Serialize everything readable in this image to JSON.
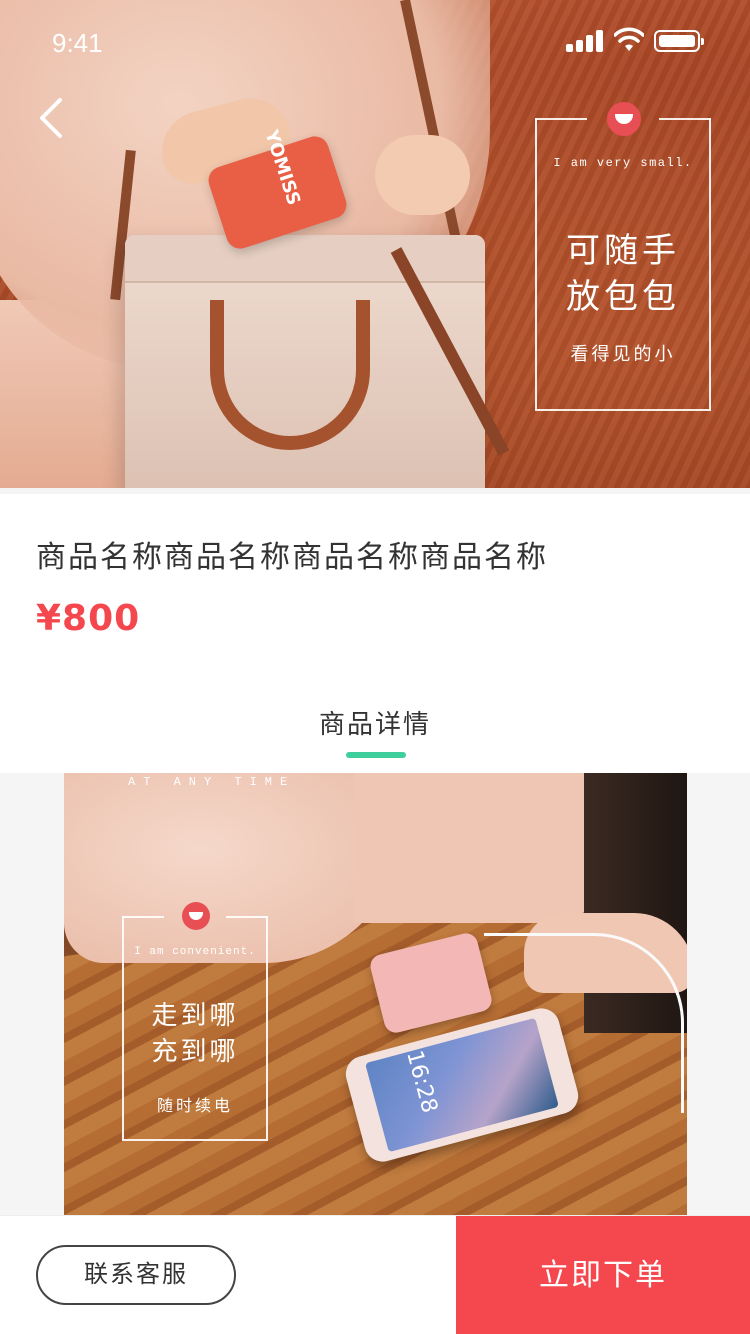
{
  "status_bar": {
    "time": "9:41"
  },
  "hero": {
    "promo": {
      "tagline_en": "I am very small.",
      "headline_line1": "可随手",
      "headline_line2": "放包包",
      "subline": "看得见的小"
    },
    "powerbank_text": "YOMISS"
  },
  "product": {
    "title": "商品名称商品名称商品名称商品名称",
    "price": "¥800"
  },
  "tabs": {
    "detail_label": "商品详情",
    "active_color": "#3fcf9d"
  },
  "detail_image": {
    "top_text": "AT ANY TIME",
    "promo": {
      "tagline_en": "I am convenient.",
      "headline_line1": "走到哪",
      "headline_line2": "充到哪",
      "subline": "随时续电"
    },
    "phone_time": "16:28"
  },
  "bottom_bar": {
    "contact_label": "联系客服",
    "order_label": "立即下单",
    "order_color": "#f4474e"
  },
  "icons": [
    "back-arrow-icon",
    "signal-icon",
    "wifi-icon",
    "battery-icon",
    "brand-logo-icon"
  ]
}
